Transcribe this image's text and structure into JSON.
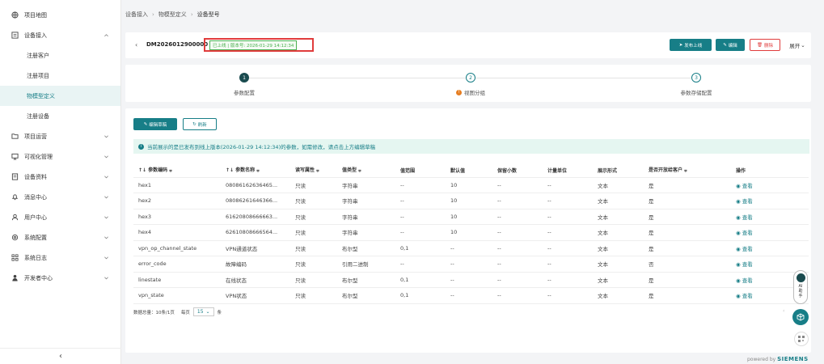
{
  "sidebar": {
    "items": [
      {
        "label": "项目地图",
        "icon": "globe-icon"
      },
      {
        "label": "设备接入",
        "icon": "device-icon"
      },
      {
        "label": "注册客户"
      },
      {
        "label": "注册项目"
      },
      {
        "label": "物模型定义"
      },
      {
        "label": "注册设备"
      },
      {
        "label": "项目运营",
        "icon": "folder-icon"
      },
      {
        "label": "可视化管理",
        "icon": "monitor-icon"
      },
      {
        "label": "设备资料",
        "icon": "book-icon"
      },
      {
        "label": "消息中心",
        "icon": "bell-icon"
      },
      {
        "label": "用户中心",
        "icon": "user-icon"
      },
      {
        "label": "系统配置",
        "icon": "gear-icon"
      },
      {
        "label": "系统日志",
        "icon": "grid-icon"
      },
      {
        "label": "开发者中心",
        "icon": "developer-icon"
      }
    ],
    "collapse_label": "‹"
  },
  "breadcrumb": [
    "设备接入",
    "物模型定义",
    "设备型号"
  ],
  "header": {
    "model_id": "DM2026012900000",
    "status": "已上线 | 版本号: 2026-01-29 14:12:34",
    "publish": "发布上线",
    "edit": "编辑",
    "delete": "删除",
    "expand": "展开"
  },
  "steps": [
    {
      "num": "1",
      "label": "参数配置"
    },
    {
      "num": "2",
      "label": "视图分组"
    },
    {
      "num": "3",
      "label": "参数存储配置"
    }
  ],
  "toolbar": {
    "edit_draft": "编辑草稿",
    "refresh": "刷新"
  },
  "alert": "当前展示的是已发布到线上版本(2026-01-29 14:12:34)的参数，如需修改，请点击上方编辑草稿",
  "table": {
    "headers": [
      "参数编码",
      "参数名称",
      "读写属性",
      "值类型",
      "值范围",
      "默认值",
      "保留小数",
      "计量单位",
      "展示形式",
      "是否开放给客户",
      "操作"
    ],
    "rows": [
      [
        "hex1",
        "08086162636465...",
        "只读",
        "字符串",
        "--",
        "10",
        "--",
        "--",
        "文本",
        "是",
        "查看"
      ],
      [
        "hex2",
        "08086261646366...",
        "只读",
        "字符串",
        "--",
        "10",
        "--",
        "--",
        "文本",
        "是",
        "查看"
      ],
      [
        "hex3",
        "61620808666663...",
        "只读",
        "字符串",
        "--",
        "10",
        "--",
        "--",
        "文本",
        "是",
        "查看"
      ],
      [
        "hex4",
        "62610808666564...",
        "只读",
        "字符串",
        "--",
        "10",
        "--",
        "--",
        "文本",
        "是",
        "查看"
      ],
      [
        "vpn_op_channel_state",
        "VPN通道状态",
        "只读",
        "布尔型",
        "0,1",
        "--",
        "--",
        "--",
        "文本",
        "是",
        "查看"
      ],
      [
        "error_code",
        "故障编码",
        "只读",
        "引用二进制",
        "--",
        "--",
        "--",
        "--",
        "文本",
        "否",
        "查看"
      ],
      [
        "linestate",
        "在线状态",
        "只读",
        "布尔型",
        "0,1",
        "--",
        "--",
        "--",
        "文本",
        "是",
        "查看"
      ],
      [
        "vpn_state",
        "VPN状态",
        "只读",
        "布尔型",
        "0,1",
        "--",
        "--",
        "--",
        "文本",
        "是",
        "查看"
      ]
    ]
  },
  "pager": {
    "total": "数据总量：10条/1页",
    "per_page": "每页",
    "size": "15",
    "unit": "条"
  },
  "ai": {
    "label": "AI助手"
  },
  "footer": {
    "powered": "powered by",
    "brand": "SIEMENS"
  },
  "colors": {
    "accent": "#177e87",
    "danger": "#e03c3c",
    "success": "#4caf50"
  }
}
